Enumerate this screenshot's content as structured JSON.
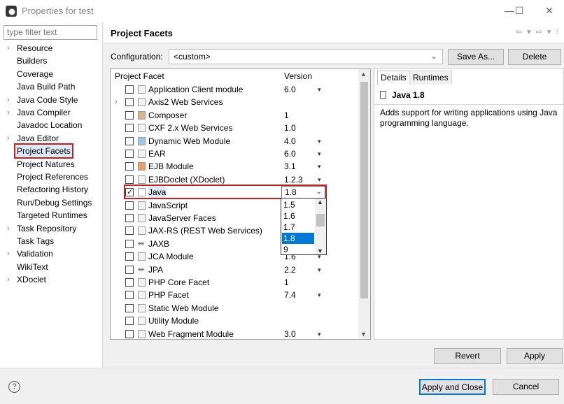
{
  "window": {
    "title": "Properties for test",
    "controls": {
      "minimize": "—",
      "maximize": "☐",
      "close": "✕"
    }
  },
  "left": {
    "filter_placeholder": "type filter text",
    "tree": [
      {
        "label": "Resource",
        "arrow": true
      },
      {
        "label": "Builders",
        "arrow": false
      },
      {
        "label": "Coverage",
        "arrow": false
      },
      {
        "label": "Java Build Path",
        "arrow": false
      },
      {
        "label": "Java Code Style",
        "arrow": true
      },
      {
        "label": "Java Compiler",
        "arrow": true
      },
      {
        "label": "Javadoc Location",
        "arrow": false
      },
      {
        "label": "Java Editor",
        "arrow": true
      },
      {
        "label": "Project Facets",
        "arrow": false,
        "selected": true
      },
      {
        "label": "Project Natures",
        "arrow": false
      },
      {
        "label": "Project References",
        "arrow": false
      },
      {
        "label": "Refactoring History",
        "arrow": false
      },
      {
        "label": "Run/Debug Settings",
        "arrow": false
      },
      {
        "label": "Targeted Runtimes",
        "arrow": false
      },
      {
        "label": "Task Repository",
        "arrow": true
      },
      {
        "label": "Task Tags",
        "arrow": false
      },
      {
        "label": "Validation",
        "arrow": true
      },
      {
        "label": "WikiText",
        "arrow": false
      },
      {
        "label": "XDoclet",
        "arrow": true
      }
    ]
  },
  "header": {
    "title": "Project Facets",
    "nav": "⇦ ▾ ⇨ ▾ ⁝"
  },
  "config": {
    "label": "Configuration:",
    "value": "<custom>",
    "save_as": "Save As...",
    "delete": "Delete"
  },
  "facets": {
    "col_facet": "Project Facet",
    "col_version": "Version",
    "rows": [
      {
        "name": "Application Client module",
        "version": "6.0",
        "drop": true,
        "checked": false,
        "icon": "page"
      },
      {
        "name": "Axis2 Web Services",
        "version": "",
        "drop": false,
        "checked": false,
        "icon": "page",
        "expander": true
      },
      {
        "name": "Composer",
        "version": "1",
        "drop": false,
        "checked": false,
        "icon": "composer"
      },
      {
        "name": "CXF 2.x Web Services",
        "version": "1.0",
        "drop": false,
        "checked": false,
        "icon": "page"
      },
      {
        "name": "Dynamic Web Module",
        "version": "4.0",
        "drop": true,
        "checked": false,
        "icon": "web"
      },
      {
        "name": "EAR",
        "version": "6.0",
        "drop": true,
        "checked": false,
        "icon": "page"
      },
      {
        "name": "EJB Module",
        "version": "3.1",
        "drop": true,
        "checked": false,
        "icon": "ejb"
      },
      {
        "name": "EJBDoclet (XDoclet)",
        "version": "1.2.3",
        "drop": true,
        "checked": false,
        "icon": "page"
      },
      {
        "name": "Java",
        "version": "1.8",
        "drop": true,
        "checked": true,
        "icon": "java",
        "highlight": true
      },
      {
        "name": "JavaScript",
        "version": "",
        "drop": false,
        "checked": false,
        "icon": "page"
      },
      {
        "name": "JavaServer Faces",
        "version": "",
        "drop": false,
        "checked": false,
        "icon": "page"
      },
      {
        "name": "JAX-RS (REST Web Services)",
        "version": "",
        "drop": false,
        "checked": false,
        "icon": "page"
      },
      {
        "name": "JAXB",
        "version": "",
        "drop": false,
        "checked": false,
        "icon": "arrows"
      },
      {
        "name": "JCA Module",
        "version": "1.6",
        "drop": true,
        "checked": false,
        "icon": "page"
      },
      {
        "name": "JPA",
        "version": "2.2",
        "drop": true,
        "checked": false,
        "icon": "arrows"
      },
      {
        "name": "PHP Core Facet",
        "version": "1",
        "drop": false,
        "checked": false,
        "icon": "page"
      },
      {
        "name": "PHP Facet",
        "version": "7.4",
        "drop": true,
        "checked": false,
        "icon": "page"
      },
      {
        "name": "Static Web Module",
        "version": "",
        "drop": false,
        "checked": false,
        "icon": "page"
      },
      {
        "name": "Utility Module",
        "version": "",
        "drop": false,
        "checked": false,
        "icon": "page"
      },
      {
        "name": "Web Fragment Module",
        "version": "3.0",
        "drop": true,
        "checked": false,
        "icon": "page"
      }
    ],
    "java_dropdown": {
      "options": [
        "1.5",
        "1.6",
        "1.7",
        "1.8",
        "9"
      ],
      "selected": "1.8"
    }
  },
  "details": {
    "tab_details": "Details",
    "tab_runtimes": "Runtimes",
    "heading": "Java 1.8",
    "description": "Adds support for writing applications using Java programming language."
  },
  "actions": {
    "revert": "Revert",
    "apply": "Apply",
    "apply_close": "Apply and Close",
    "cancel": "Cancel",
    "help": "?"
  }
}
